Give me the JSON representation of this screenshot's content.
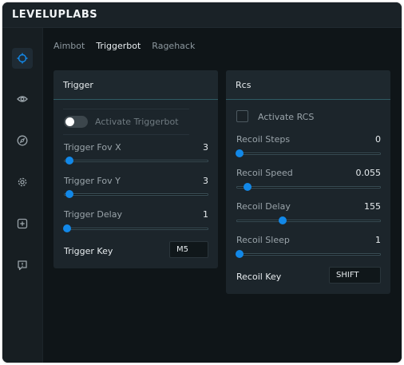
{
  "app": {
    "title": "LEVELUPLABS"
  },
  "sidebar": {
    "items": [
      {
        "icon": "crosshair-icon",
        "active": true
      },
      {
        "icon": "eye-icon",
        "active": false
      },
      {
        "icon": "compass-icon",
        "active": false
      },
      {
        "icon": "gear-icon",
        "active": false
      },
      {
        "icon": "plus-square-icon",
        "active": false
      },
      {
        "icon": "alert-message-icon",
        "active": false
      }
    ]
  },
  "tabs": [
    {
      "label": "Aimbot",
      "active": false
    },
    {
      "label": "Triggerbot",
      "active": true
    },
    {
      "label": "Ragehack",
      "active": false
    }
  ],
  "trigger_panel": {
    "title": "Trigger",
    "activate": {
      "label": "Activate Triggerbot",
      "on": false
    },
    "fov_x": {
      "label": "Trigger Fov X",
      "value": "3",
      "level": 0.02
    },
    "fov_y": {
      "label": "Trigger Fov Y",
      "value": "3",
      "level": 0.02
    },
    "delay": {
      "label": "Trigger Delay",
      "value": "1",
      "level": 0.0
    },
    "key": {
      "label": "Trigger Key",
      "value": "M5"
    }
  },
  "rcs_panel": {
    "title": "Rcs",
    "activate": {
      "label": "Activate RCS",
      "checked": false
    },
    "steps": {
      "label": "Recoil Steps",
      "value": "0",
      "level": 0.0
    },
    "speed": {
      "label": "Recoil Speed",
      "value": "0.055",
      "level": 0.06
    },
    "delay": {
      "label": "Recoil Delay",
      "value": "155",
      "level": 0.31
    },
    "sleep": {
      "label": "Recoil Sleep",
      "value": "1",
      "level": 0.0
    },
    "key": {
      "label": "Recoil Key",
      "value": "SHIFT"
    }
  },
  "colors": {
    "accent": "#1288e8",
    "header_border": "#2f5b63",
    "panel_bg": "#1c252b",
    "main_bg": "#0f1518"
  }
}
